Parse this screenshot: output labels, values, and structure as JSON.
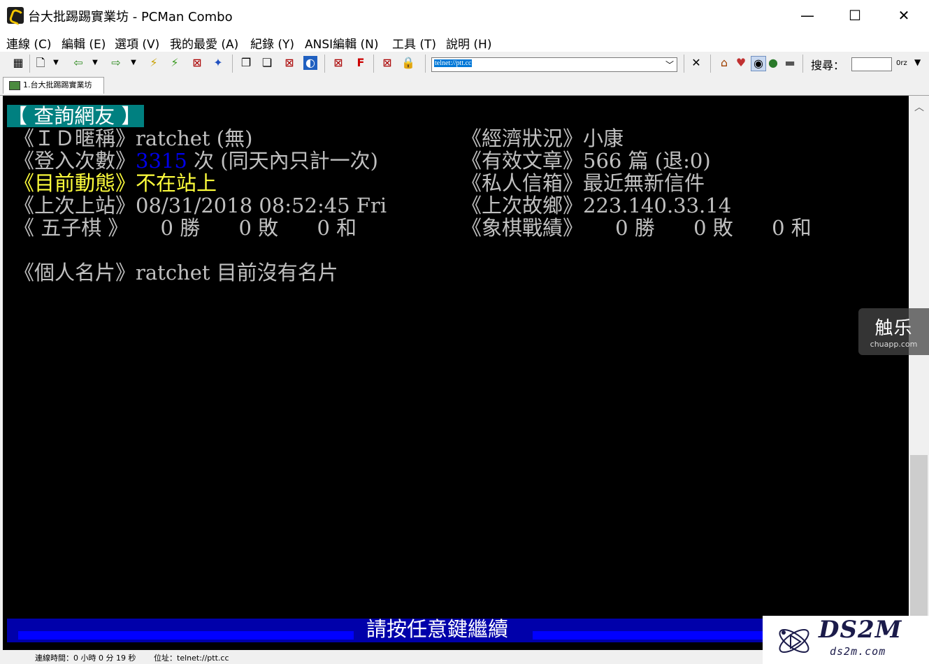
{
  "window": {
    "title": "台大批踢踢實業坊 - PCMan Combo",
    "minimize": "—",
    "maximize": "☐",
    "close": "✕"
  },
  "menu": [
    "連線 (C)",
    "編輯 (E)",
    "選項 (V)",
    "我的最愛 (A)",
    "紀錄 (Y)",
    "ANSI編輯 (N)",
    "工具 (T)",
    "說明 (H)"
  ],
  "toolbar": {
    "address_value": "telnet://ptt.cc",
    "search_label": "搜尋：",
    "search_value": "",
    "search_option": "0rz"
  },
  "tabs": [
    {
      "label": "1.台大批踢踢實業坊"
    }
  ],
  "terminal": {
    "title": "【 查詢網友 】",
    "id_label": "《ＩＤ暱稱》",
    "id_value": "ratchet (無)",
    "economy_label": "《經濟狀況》",
    "economy_value": "小康",
    "logins_label": "《登入次數》",
    "logins_count": "3315",
    "logins_suffix": " 次 (同天內只計一次)",
    "articles_label": "《有效文章》",
    "articles_value": "566 篇 (退:0)",
    "status_label": "《目前動態》",
    "status_value": "不在站上",
    "mail_label": "《私人信箱》",
    "mail_value": "最近無新信件",
    "last_login_label": "《上次上站》",
    "last_login_value": "08/31/2018 08:52:45 Fri",
    "last_ip_label": "《上次故鄉》",
    "last_ip_value": "223.140.33.14",
    "gomoku_label": "《 五子棋 》",
    "gomoku_value": "     0 勝      0 敗      0 和",
    "chess_label": "《象棋戰績》",
    "chess_value": "     0 勝      0 敗      0 和",
    "card_label": "《個人名片》",
    "card_value": "ratchet 目前沒有名片",
    "prompt": "請按任意鍵繼續"
  },
  "statusbar": {
    "connect_time": "連線時間：0 小時 0 分 19 秒",
    "address": "位址：telnet://ptt.cc"
  },
  "watermark": {
    "main": "触乐",
    "sub": "chuapp.com"
  },
  "logo": {
    "main": "DS2M",
    "sub": "ds2m.com"
  },
  "colors": {
    "terminal_bg": "#000000",
    "cyan_highlight": "#008080",
    "blue_number": "#0000e8",
    "yellow_status": "#ffff3c",
    "status_bar": "#0000aa"
  }
}
